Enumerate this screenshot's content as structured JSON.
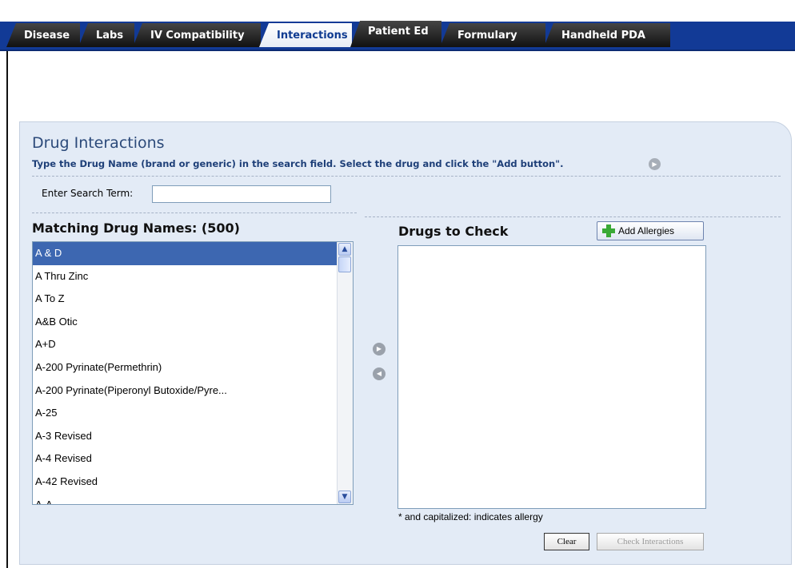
{
  "tabs": [
    {
      "label": "Disease",
      "active": false
    },
    {
      "label": "Labs",
      "active": false
    },
    {
      "label": "IV Compatibility",
      "active": false
    },
    {
      "label": "Interactions",
      "active": true
    },
    {
      "label": "Patient Ed",
      "active": false
    },
    {
      "label": "Formulary",
      "active": false
    },
    {
      "label": "Handheld PDA",
      "active": false
    }
  ],
  "panel": {
    "title": "Drug Interactions",
    "instructions": "Type the Drug Name (brand or generic) in the search field. Select the drug and click the \"Add button\"."
  },
  "search": {
    "label": "Enter Search Term:",
    "value": ""
  },
  "matching": {
    "title": "Matching Drug Names: (500)",
    "items": [
      "A & D",
      "A Thru Zinc",
      "A To Z",
      "A&B Otic",
      "A+D",
      "A-200 Pyrinate(Permethrin)",
      "A-200 Pyrinate(Piperonyl Butoxide/Pyre...",
      "A-25",
      "A-3 Revised",
      "A-4 Revised",
      "A-42 Revised",
      "A-A-..."
    ],
    "selected_index": 0
  },
  "drugs_to_check": {
    "title": "Drugs to Check",
    "add_allergies_label": "Add Allergies",
    "note": "* and capitalized: indicates allergy",
    "items": []
  },
  "buttons": {
    "clear": "Clear",
    "check_interactions": "Check Interactions"
  },
  "colors": {
    "tab_band": "#123a96",
    "active_tab_text": "#0f3b91",
    "panel_bg": "#e3ebf6",
    "selection": "#3d67b1"
  }
}
